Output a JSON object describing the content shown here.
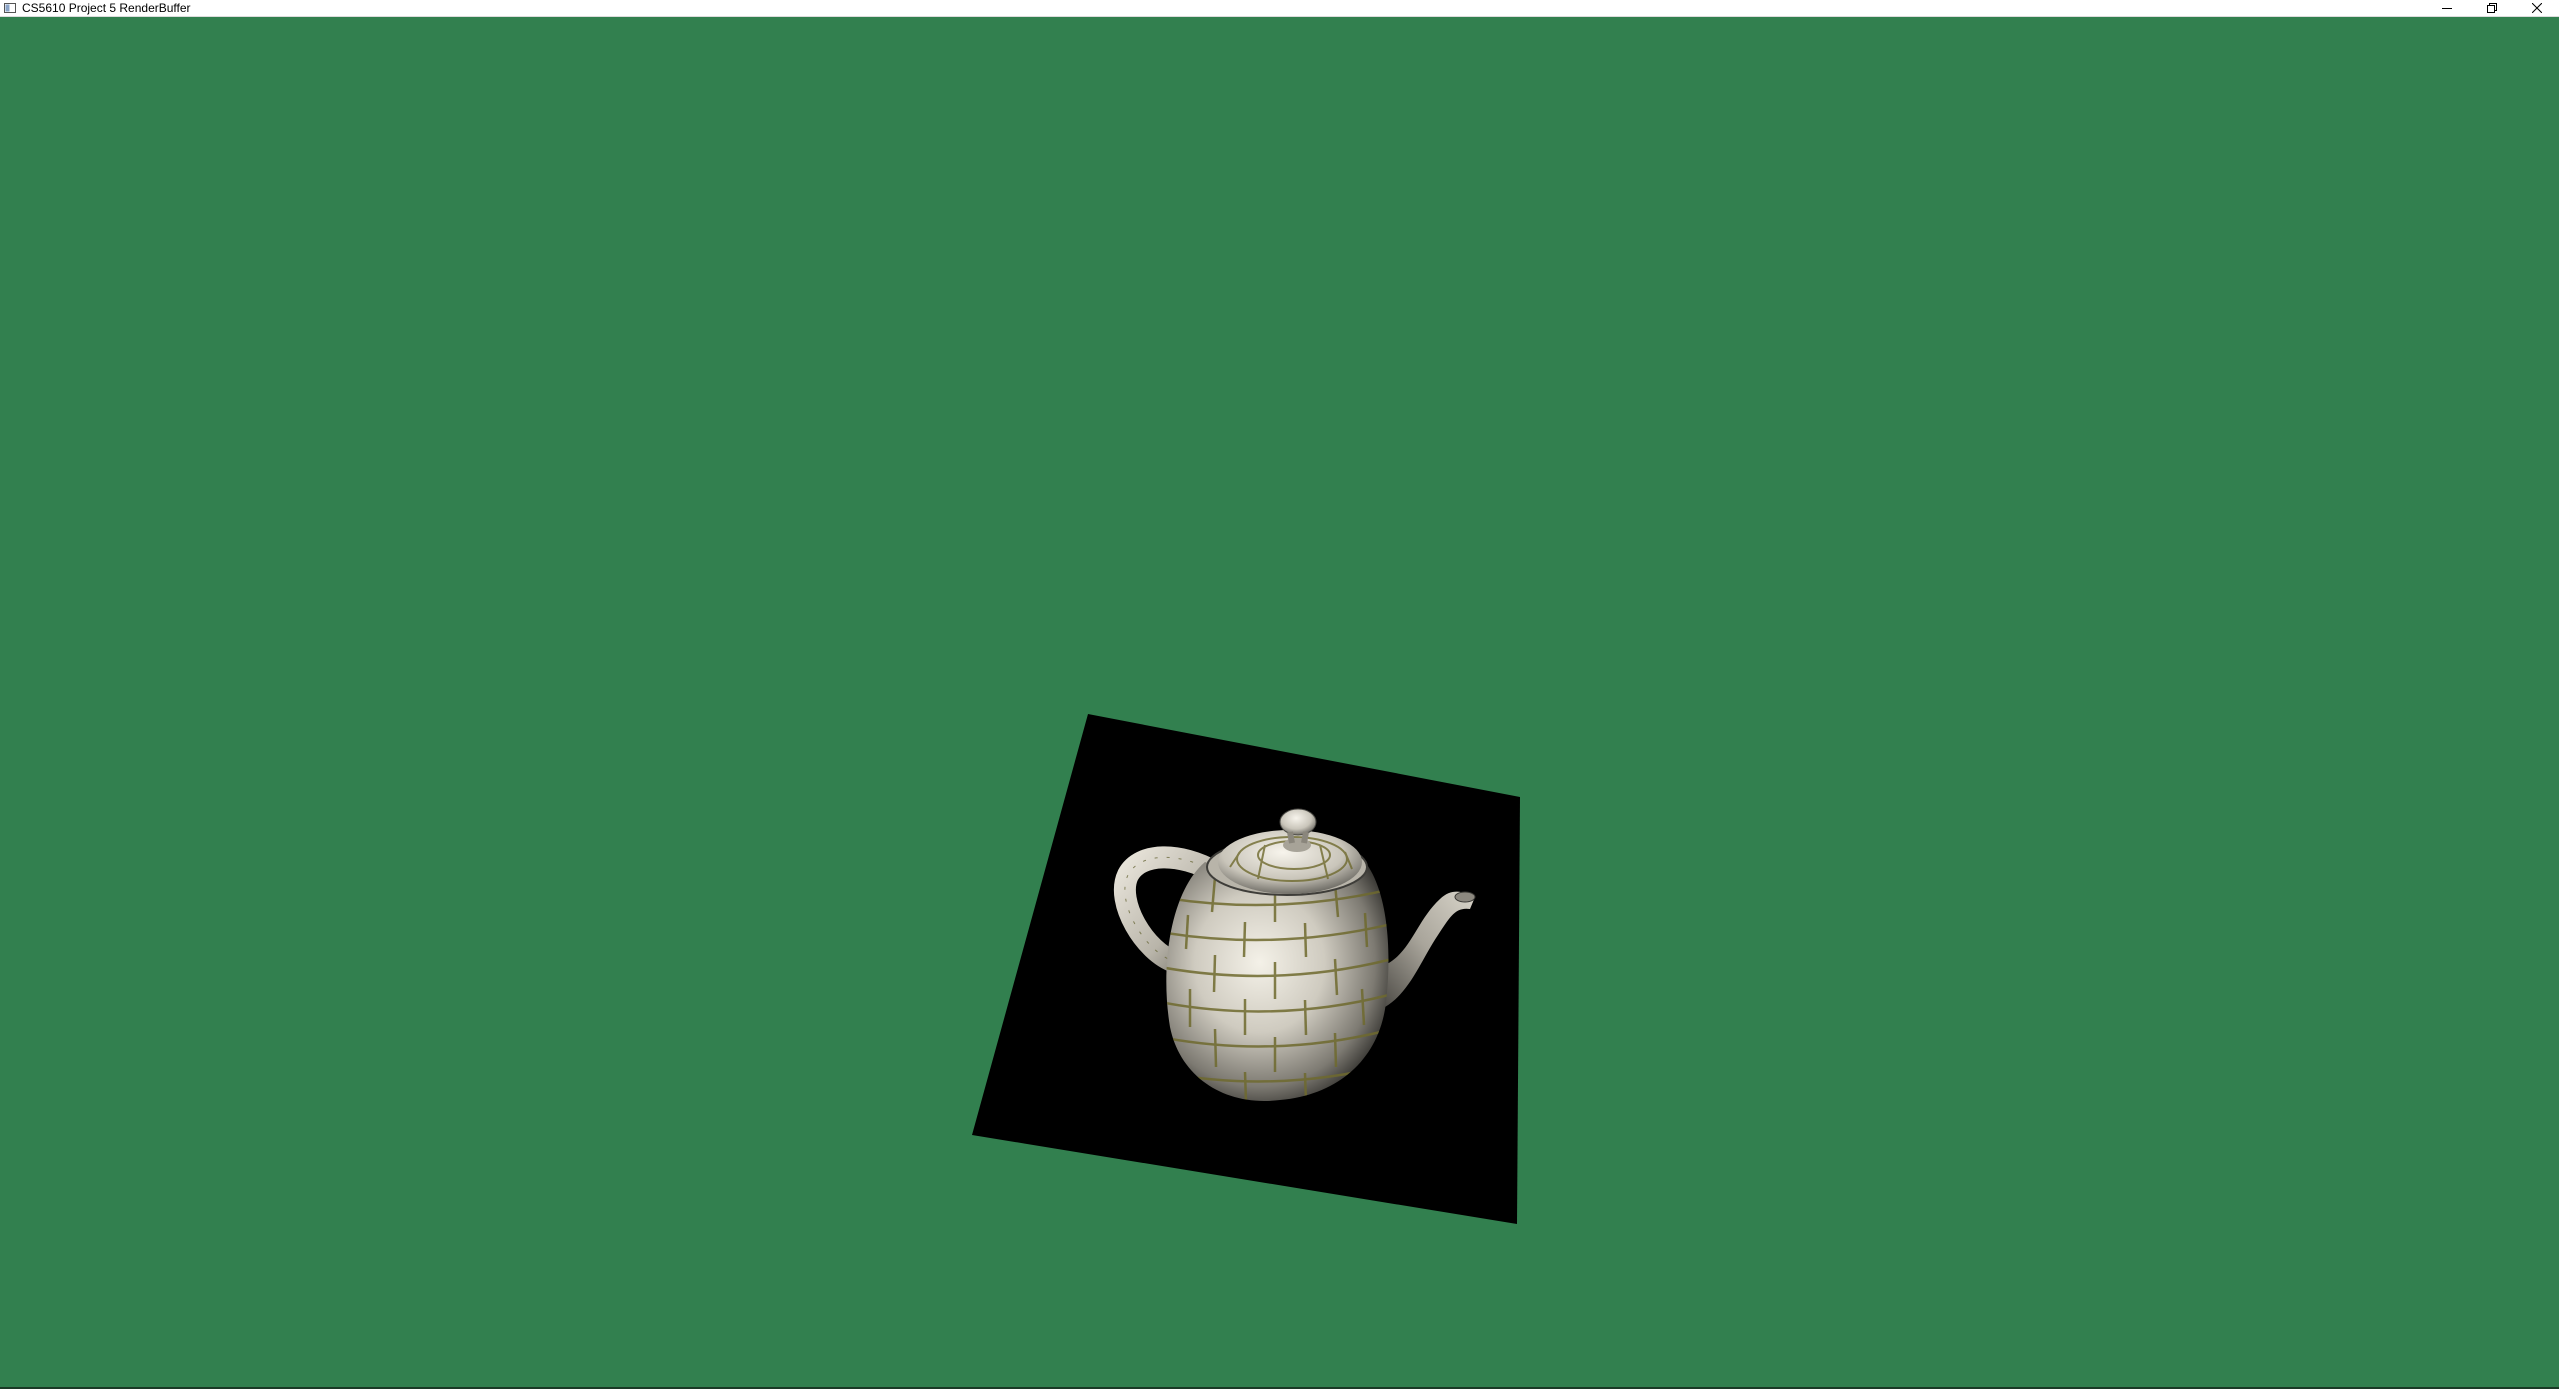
{
  "window": {
    "title": "CS5610 Project 5 RenderBuffer",
    "controls": {
      "minimize_icon": "minimize-icon",
      "restore_icon": "restore-icon",
      "close_icon": "close-icon"
    }
  },
  "scene": {
    "background_color": "#32804f",
    "plane_color": "#000000",
    "object": "teapot",
    "texture": "brick"
  }
}
